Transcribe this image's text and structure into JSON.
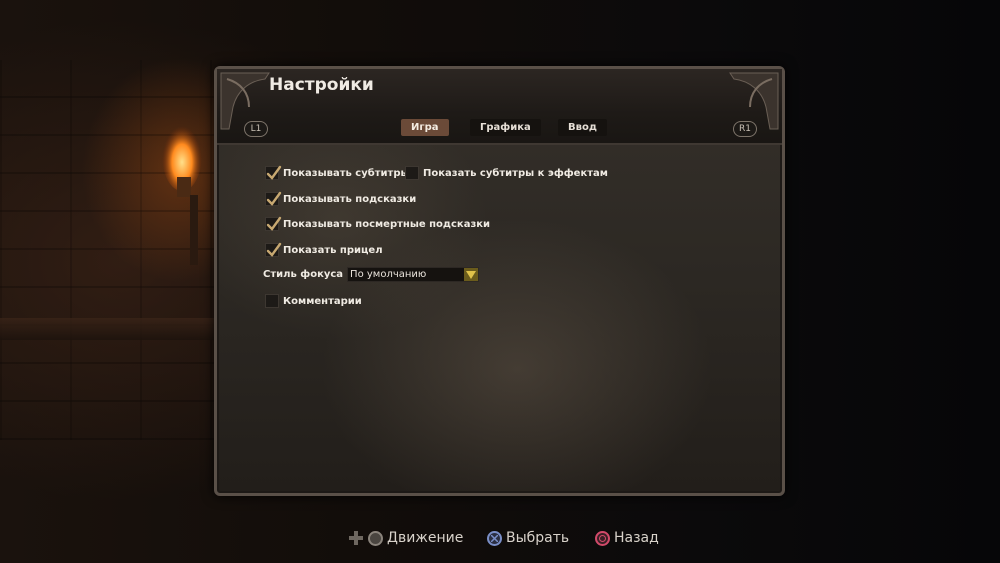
{
  "panel": {
    "title": "Настройки"
  },
  "shoulders": {
    "left": "L1",
    "right": "R1"
  },
  "tabs": [
    {
      "label": "Игра",
      "active": true
    },
    {
      "label": "Графика",
      "active": false
    },
    {
      "label": "Ввод",
      "active": false
    }
  ],
  "options": {
    "subtitles": {
      "label": "Показывать субтитры",
      "checked": true
    },
    "effect_subtitles": {
      "label": "Показать субтитры к эффектам",
      "checked": false
    },
    "hints": {
      "label": "Показывать подсказки",
      "checked": true
    },
    "posthumous_hints": {
      "label": "Показывать посмертные подсказки",
      "checked": true
    },
    "crosshair": {
      "label": "Показать прицел",
      "checked": true
    },
    "focus_style": {
      "label": "Стиль фокуса",
      "value": "По умолчанию"
    },
    "commentary": {
      "label": "Комментарии",
      "checked": false
    }
  },
  "footer": {
    "move": {
      "label": "Движение",
      "icon": "dpad-left-stick-icon"
    },
    "select": {
      "label": "Выбрать",
      "icon": "cross-button-icon"
    },
    "back": {
      "label": "Назад",
      "icon": "circle-button-icon"
    }
  },
  "colors": {
    "check": "#c7a871",
    "active_tab": "#6b4a38",
    "cross_button": "#7a8fc7",
    "circle_button": "#d24a6a",
    "dropdown_arrow": "#e0c24a"
  }
}
